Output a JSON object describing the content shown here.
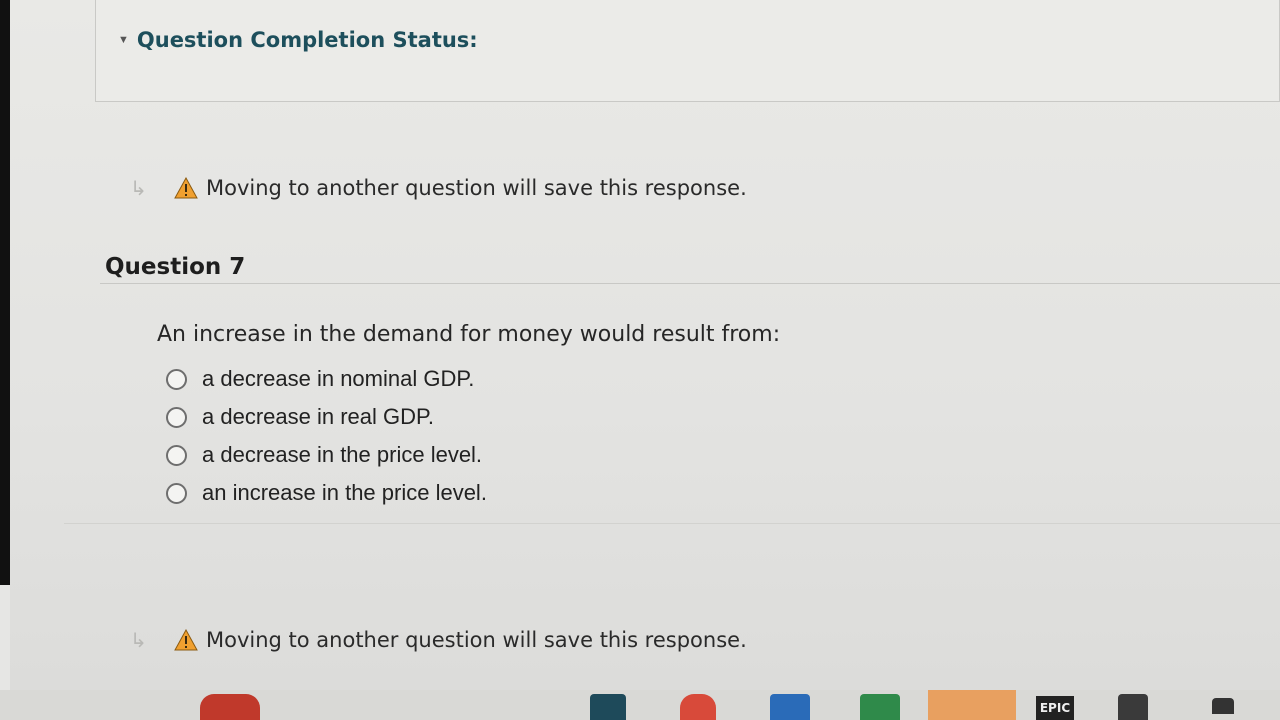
{
  "status": {
    "title": "Question Completion Status:"
  },
  "notices": {
    "top": "Moving to another question will save this response.",
    "bottom": "Moving to another question will save this response."
  },
  "question": {
    "title": "Question 7",
    "text": "An increase in the demand for money would result from:",
    "options": [
      "a decrease in nominal GDP.",
      "a decrease in real GDP.",
      "a decrease in the price level.",
      "an increase in the price level."
    ],
    "selected": null
  },
  "taskbar": {
    "epic_label": "EPIC"
  },
  "colors": {
    "title_teal": "#1d4f5c",
    "warning_orange": "#f0a030",
    "background": "#e6e6e4"
  }
}
